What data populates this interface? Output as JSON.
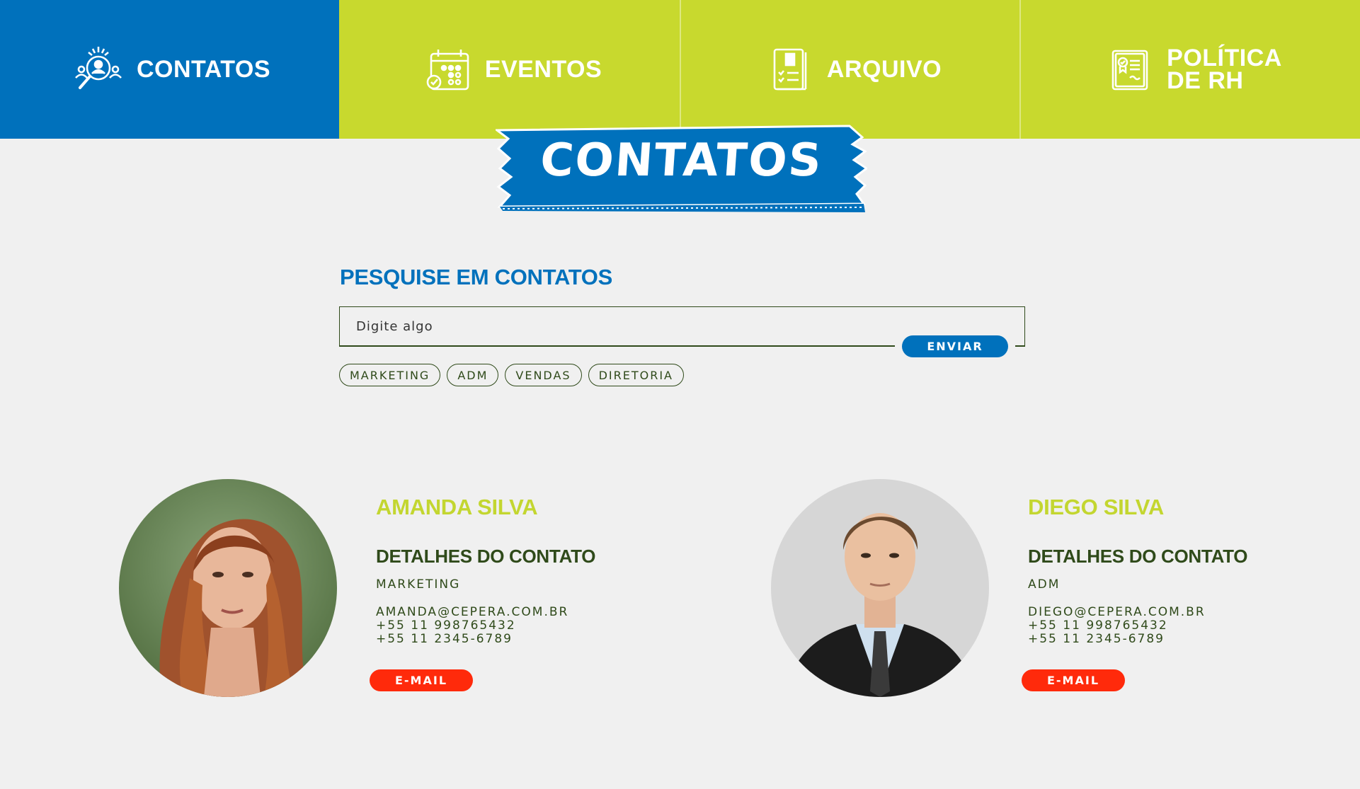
{
  "nav": {
    "items": [
      {
        "label": "CONTATOS",
        "icon": "contacts-search-icon",
        "active": true
      },
      {
        "label": "EVENTOS",
        "icon": "calendar-icon",
        "active": false
      },
      {
        "label": "ARQUIVO",
        "icon": "archive-document-icon",
        "active": false
      },
      {
        "label": "POLÍTICA\nDE RH",
        "icon": "certificate-document-icon",
        "active": false
      }
    ]
  },
  "banner": {
    "title": "CONTATOS"
  },
  "search": {
    "title": "PESQUISE EM CONTATOS",
    "placeholder": "Digite algo",
    "submit_label": "ENVIAR",
    "tags": [
      "MARKETING",
      "ADM",
      "VENDAS",
      "DIRETORIA"
    ]
  },
  "contacts": [
    {
      "name": "AMANDA SILVA",
      "details_title": "DETALHES DO CONTATO",
      "department": "MARKETING",
      "email": "AMANDA@CEPERA.COM.BR",
      "phone_mobile": "+55 11 998765432",
      "phone_landline": "+55 11 2345-6789",
      "email_button": "E-MAIL"
    },
    {
      "name": "DIEGO SILVA",
      "details_title": "DETALHES DO CONTATO",
      "department": "ADM",
      "email": "DIEGO@CEPERA.COM.BR",
      "phone_mobile": "+55 11 998765432",
      "phone_landline": "+55 11 2345-6789",
      "email_button": "E-MAIL"
    }
  ],
  "colors": {
    "primary_blue": "#0071bc",
    "lime": "#c8d92e",
    "dark_green": "#2f4a1a",
    "email_red": "#ff2a0b",
    "background": "#f0f0f0"
  }
}
